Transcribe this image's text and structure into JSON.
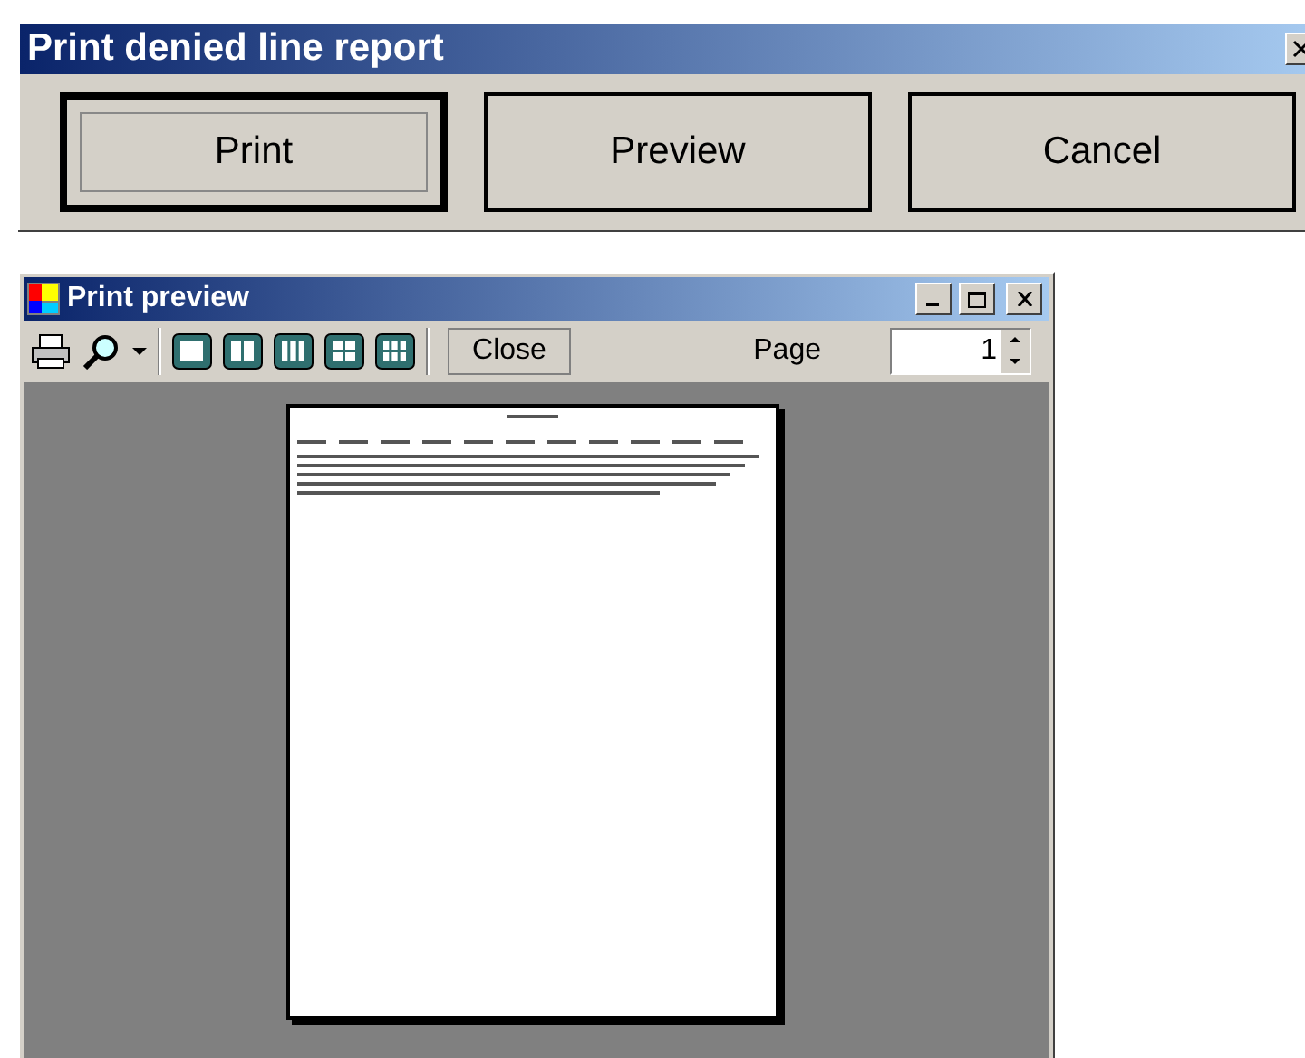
{
  "dialog": {
    "title": "Print denied line report",
    "buttons": [
      {
        "label": "Print",
        "default": true
      },
      {
        "label": "Preview",
        "default": false
      },
      {
        "label": "Cancel",
        "default": false
      }
    ]
  },
  "preview_window": {
    "title": "Print preview",
    "toolbar": {
      "close_button": "Close",
      "page_label": "Page",
      "page_value": "1"
    }
  }
}
